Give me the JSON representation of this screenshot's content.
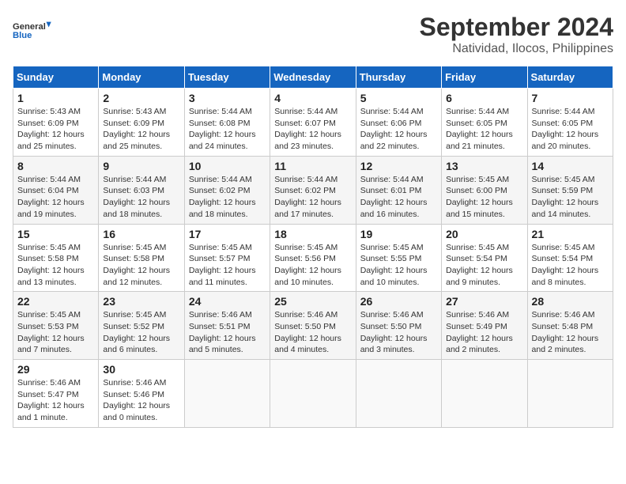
{
  "header": {
    "logo_line1": "General",
    "logo_line2": "Blue",
    "main_title": "September 2024",
    "sub_title": "Natividad, Ilocos, Philippines"
  },
  "weekdays": [
    "Sunday",
    "Monday",
    "Tuesday",
    "Wednesday",
    "Thursday",
    "Friday",
    "Saturday"
  ],
  "weeks": [
    [
      {
        "day": "1",
        "lines": [
          "Sunrise: 5:43 AM",
          "Sunset: 6:09 PM",
          "Daylight: 12 hours",
          "and 25 minutes."
        ]
      },
      {
        "day": "2",
        "lines": [
          "Sunrise: 5:43 AM",
          "Sunset: 6:09 PM",
          "Daylight: 12 hours",
          "and 25 minutes."
        ]
      },
      {
        "day": "3",
        "lines": [
          "Sunrise: 5:44 AM",
          "Sunset: 6:08 PM",
          "Daylight: 12 hours",
          "and 24 minutes."
        ]
      },
      {
        "day": "4",
        "lines": [
          "Sunrise: 5:44 AM",
          "Sunset: 6:07 PM",
          "Daylight: 12 hours",
          "and 23 minutes."
        ]
      },
      {
        "day": "5",
        "lines": [
          "Sunrise: 5:44 AM",
          "Sunset: 6:06 PM",
          "Daylight: 12 hours",
          "and 22 minutes."
        ]
      },
      {
        "day": "6",
        "lines": [
          "Sunrise: 5:44 AM",
          "Sunset: 6:05 PM",
          "Daylight: 12 hours",
          "and 21 minutes."
        ]
      },
      {
        "day": "7",
        "lines": [
          "Sunrise: 5:44 AM",
          "Sunset: 6:05 PM",
          "Daylight: 12 hours",
          "and 20 minutes."
        ]
      }
    ],
    [
      {
        "day": "8",
        "lines": [
          "Sunrise: 5:44 AM",
          "Sunset: 6:04 PM",
          "Daylight: 12 hours",
          "and 19 minutes."
        ]
      },
      {
        "day": "9",
        "lines": [
          "Sunrise: 5:44 AM",
          "Sunset: 6:03 PM",
          "Daylight: 12 hours",
          "and 18 minutes."
        ]
      },
      {
        "day": "10",
        "lines": [
          "Sunrise: 5:44 AM",
          "Sunset: 6:02 PM",
          "Daylight: 12 hours",
          "and 18 minutes."
        ]
      },
      {
        "day": "11",
        "lines": [
          "Sunrise: 5:44 AM",
          "Sunset: 6:02 PM",
          "Daylight: 12 hours",
          "and 17 minutes."
        ]
      },
      {
        "day": "12",
        "lines": [
          "Sunrise: 5:44 AM",
          "Sunset: 6:01 PM",
          "Daylight: 12 hours",
          "and 16 minutes."
        ]
      },
      {
        "day": "13",
        "lines": [
          "Sunrise: 5:45 AM",
          "Sunset: 6:00 PM",
          "Daylight: 12 hours",
          "and 15 minutes."
        ]
      },
      {
        "day": "14",
        "lines": [
          "Sunrise: 5:45 AM",
          "Sunset: 5:59 PM",
          "Daylight: 12 hours",
          "and 14 minutes."
        ]
      }
    ],
    [
      {
        "day": "15",
        "lines": [
          "Sunrise: 5:45 AM",
          "Sunset: 5:58 PM",
          "Daylight: 12 hours",
          "and 13 minutes."
        ]
      },
      {
        "day": "16",
        "lines": [
          "Sunrise: 5:45 AM",
          "Sunset: 5:58 PM",
          "Daylight: 12 hours",
          "and 12 minutes."
        ]
      },
      {
        "day": "17",
        "lines": [
          "Sunrise: 5:45 AM",
          "Sunset: 5:57 PM",
          "Daylight: 12 hours",
          "and 11 minutes."
        ]
      },
      {
        "day": "18",
        "lines": [
          "Sunrise: 5:45 AM",
          "Sunset: 5:56 PM",
          "Daylight: 12 hours",
          "and 10 minutes."
        ]
      },
      {
        "day": "19",
        "lines": [
          "Sunrise: 5:45 AM",
          "Sunset: 5:55 PM",
          "Daylight: 12 hours",
          "and 10 minutes."
        ]
      },
      {
        "day": "20",
        "lines": [
          "Sunrise: 5:45 AM",
          "Sunset: 5:54 PM",
          "Daylight: 12 hours",
          "and 9 minutes."
        ]
      },
      {
        "day": "21",
        "lines": [
          "Sunrise: 5:45 AM",
          "Sunset: 5:54 PM",
          "Daylight: 12 hours",
          "and 8 minutes."
        ]
      }
    ],
    [
      {
        "day": "22",
        "lines": [
          "Sunrise: 5:45 AM",
          "Sunset: 5:53 PM",
          "Daylight: 12 hours",
          "and 7 minutes."
        ]
      },
      {
        "day": "23",
        "lines": [
          "Sunrise: 5:45 AM",
          "Sunset: 5:52 PM",
          "Daylight: 12 hours",
          "and 6 minutes."
        ]
      },
      {
        "day": "24",
        "lines": [
          "Sunrise: 5:46 AM",
          "Sunset: 5:51 PM",
          "Daylight: 12 hours",
          "and 5 minutes."
        ]
      },
      {
        "day": "25",
        "lines": [
          "Sunrise: 5:46 AM",
          "Sunset: 5:50 PM",
          "Daylight: 12 hours",
          "and 4 minutes."
        ]
      },
      {
        "day": "26",
        "lines": [
          "Sunrise: 5:46 AM",
          "Sunset: 5:50 PM",
          "Daylight: 12 hours",
          "and 3 minutes."
        ]
      },
      {
        "day": "27",
        "lines": [
          "Sunrise: 5:46 AM",
          "Sunset: 5:49 PM",
          "Daylight: 12 hours",
          "and 2 minutes."
        ]
      },
      {
        "day": "28",
        "lines": [
          "Sunrise: 5:46 AM",
          "Sunset: 5:48 PM",
          "Daylight: 12 hours",
          "and 2 minutes."
        ]
      }
    ],
    [
      {
        "day": "29",
        "lines": [
          "Sunrise: 5:46 AM",
          "Sunset: 5:47 PM",
          "Daylight: 12 hours",
          "and 1 minute."
        ]
      },
      {
        "day": "30",
        "lines": [
          "Sunrise: 5:46 AM",
          "Sunset: 5:46 PM",
          "Daylight: 12 hours",
          "and 0 minutes."
        ]
      },
      null,
      null,
      null,
      null,
      null
    ]
  ]
}
